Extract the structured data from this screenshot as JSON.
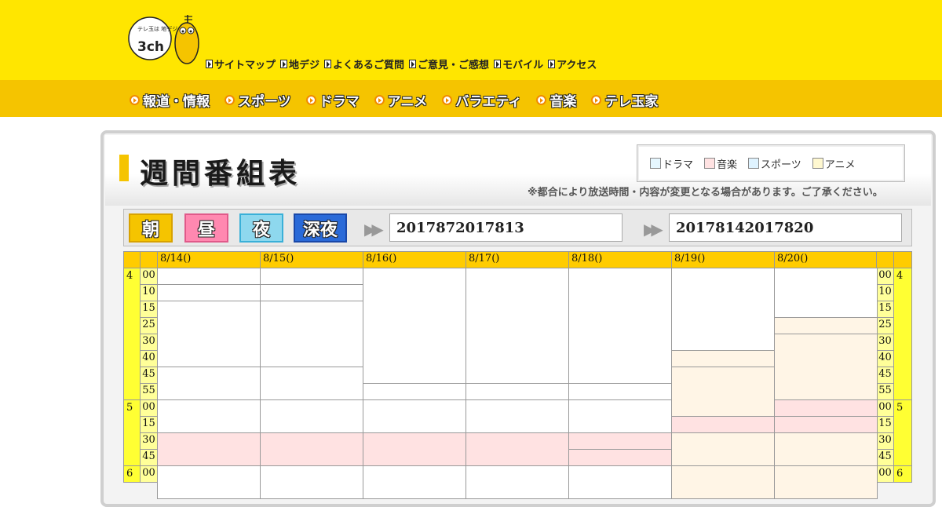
{
  "logo": {
    "small_text": "テレ玉は 地デジ",
    "channel": "3ch"
  },
  "util_nav": [
    {
      "label": "サイトマップ"
    },
    {
      "label": "地デジ"
    },
    {
      "label": "よくあるご質問"
    },
    {
      "label": "ご意見・ご感想"
    },
    {
      "label": "モバイル"
    },
    {
      "label": "アクセス"
    }
  ],
  "global_nav": [
    {
      "label": "報道・情報"
    },
    {
      "label": "スポーツ"
    },
    {
      "label": "ドラマ"
    },
    {
      "label": "アニメ"
    },
    {
      "label": "バラエティ"
    },
    {
      "label": "音楽"
    },
    {
      "label": "テレ玉家"
    }
  ],
  "page_title": "週間番組表",
  "legend": [
    {
      "label": "ドラマ",
      "color": "#e6f7ff"
    },
    {
      "label": "音楽",
      "color": "#ffe2e2"
    },
    {
      "label": "スポーツ",
      "color": "#dff3ff"
    },
    {
      "label": "アニメ",
      "color": "#fff8d0"
    }
  ],
  "notice": "※都合により放送時間・内容が変更となる場合があります。ご了承ください。",
  "time_bands": [
    {
      "label": "朝",
      "key": "asa"
    },
    {
      "label": "昼",
      "key": "hiru"
    },
    {
      "label": "夜",
      "key": "yoru"
    },
    {
      "label": "深夜",
      "key": "shinya"
    }
  ],
  "week_nav": {
    "prev_week": "2017872017813",
    "next_week": "20178142017820"
  },
  "schedule": {
    "days": [
      "8/14()",
      "8/15()",
      "8/16()",
      "8/17()",
      "8/18()",
      "8/19()",
      "8/20()"
    ],
    "hours": [
      {
        "hour": "4",
        "minutes": [
          "00",
          "10",
          "15",
          "25",
          "30",
          "40",
          "45",
          "55"
        ]
      },
      {
        "hour": "5",
        "minutes": [
          "00",
          "15",
          "30",
          "45"
        ]
      },
      {
        "hour": "6",
        "minutes": [
          "00"
        ]
      }
    ]
  }
}
